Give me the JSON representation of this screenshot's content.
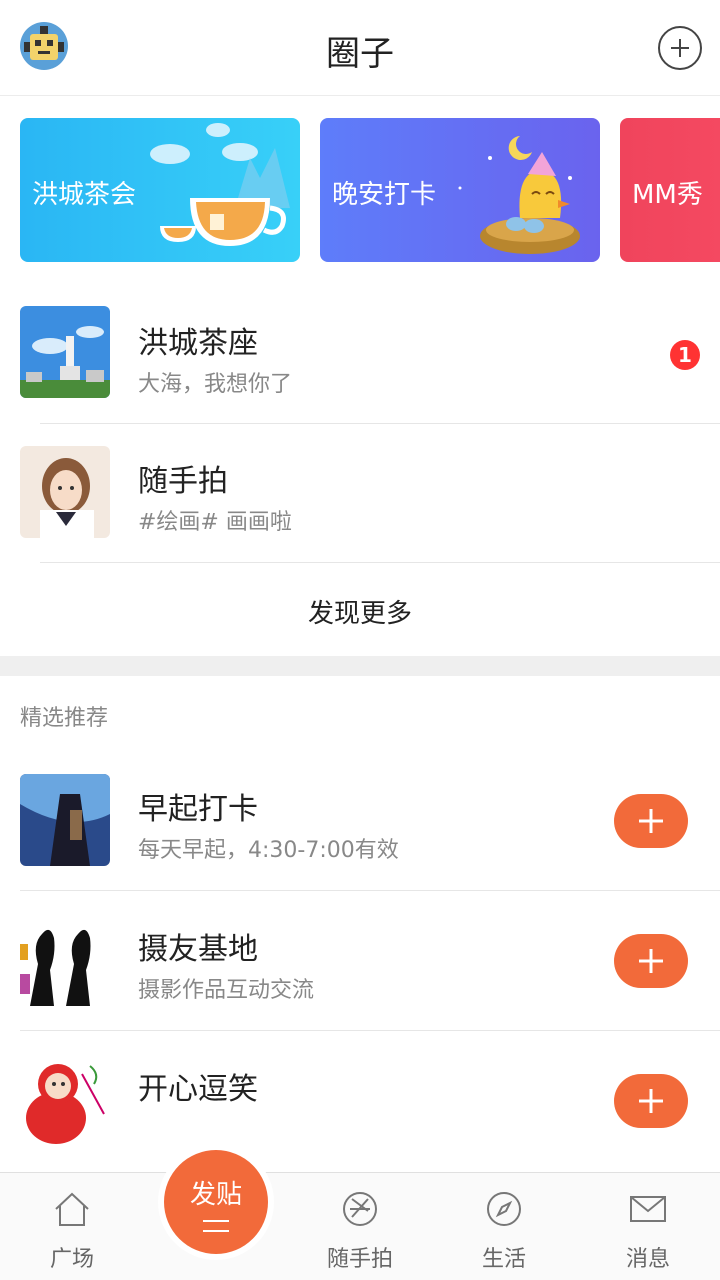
{
  "header": {
    "title": "圈子",
    "avatar_icon": "robot-avatar-icon",
    "add_icon": "plus-circle-icon"
  },
  "banners": [
    {
      "label": "洪城茶会",
      "color": "#2ab6f4"
    },
    {
      "label": "晚安打卡",
      "color": "#5e7dfa"
    },
    {
      "label": "MM秀",
      "color": "#f0445c"
    }
  ],
  "my_circles": [
    {
      "title": "洪城茶座",
      "subtitle": "大海，我想你了",
      "badge": "1"
    },
    {
      "title": "随手拍",
      "subtitle": "#绘画# 画画啦"
    }
  ],
  "discover_more": "发现更多",
  "recommend": {
    "section_title": "精选推荐",
    "items": [
      {
        "title": "早起打卡",
        "subtitle": "每天早起，4:30-7:00有效"
      },
      {
        "title": "摄友基地",
        "subtitle": "摄影作品互动交流"
      },
      {
        "title": "开心逗笑",
        "subtitle": ""
      }
    ]
  },
  "tabbar": {
    "tabs": [
      {
        "label": "广场",
        "icon": "home-icon"
      },
      {
        "label": "随手拍",
        "icon": "aperture-icon"
      },
      {
        "label": "生活",
        "icon": "compass-icon"
      },
      {
        "label": "消息",
        "icon": "mail-icon"
      }
    ],
    "post_label": "发贴",
    "post_icon": "menu-lines-icon"
  },
  "colors": {
    "accent": "#f26a3a",
    "badge": "#ff3333"
  }
}
